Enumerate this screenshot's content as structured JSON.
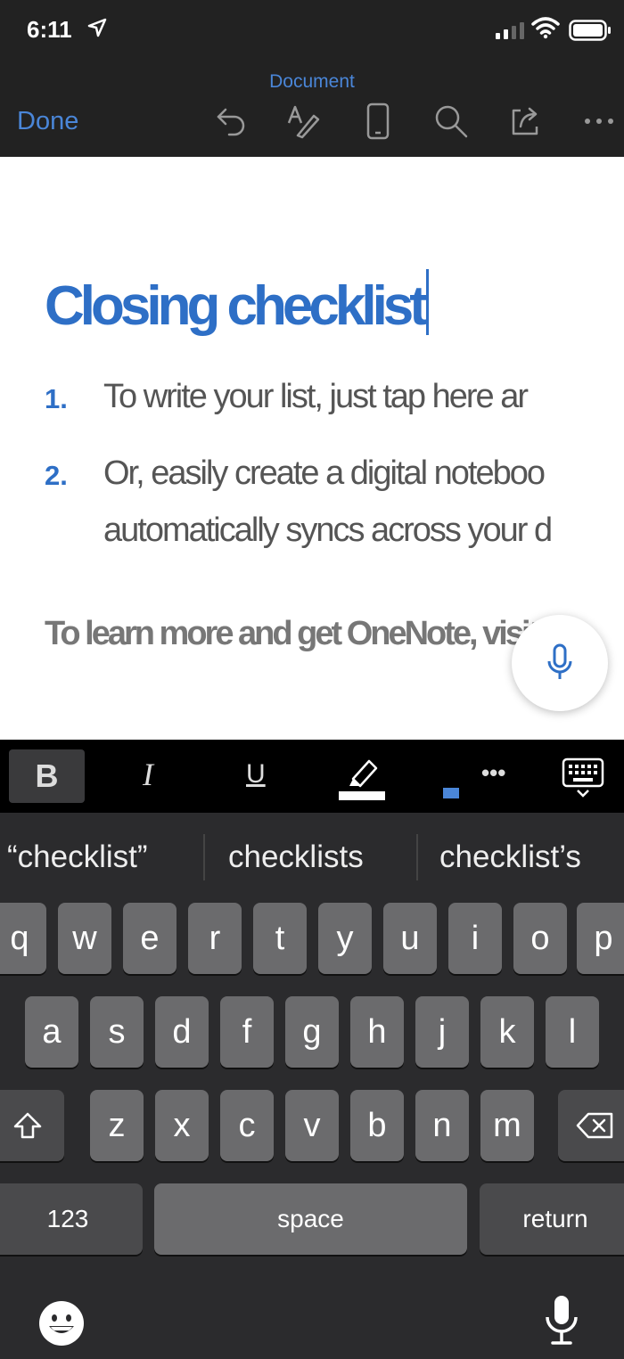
{
  "status_bar": {
    "time": "6:11"
  },
  "toolbar": {
    "title": "Document",
    "done_label": "Done",
    "icons": [
      "undo-icon",
      "format-text-icon",
      "mobile-view-icon",
      "search-icon",
      "share-icon",
      "more-icon"
    ]
  },
  "document": {
    "heading": "Closing checklist",
    "list": [
      {
        "num": "1.",
        "lines": [
          "To write your list, just tap here ar"
        ]
      },
      {
        "num": "2.",
        "lines": [
          "Or, easily create a digital noteboo",
          "automatically syncs across your d"
        ]
      }
    ],
    "footer_line": "To learn more and get OneNote, visit"
  },
  "format_bar": {
    "bold": "B",
    "italic": "I",
    "underline": "U",
    "more": "•••",
    "font_color": "#4a86d8"
  },
  "keyboard": {
    "suggestions": [
      "“checklist”",
      "checklists",
      "checklist’s"
    ],
    "row1": [
      "q",
      "w",
      "e",
      "r",
      "t",
      "y",
      "u",
      "i",
      "o",
      "p"
    ],
    "row2": [
      "a",
      "s",
      "d",
      "f",
      "g",
      "h",
      "j",
      "k",
      "l"
    ],
    "row3": [
      "z",
      "x",
      "c",
      "v",
      "b",
      "n",
      "m"
    ],
    "numbers_label": "123",
    "space_label": "space",
    "return_label": "return"
  },
  "colors": {
    "accent": "#2e6fc6",
    "keyboard_bg": "#2b2b2d",
    "key_bg": "#6b6b6d"
  }
}
